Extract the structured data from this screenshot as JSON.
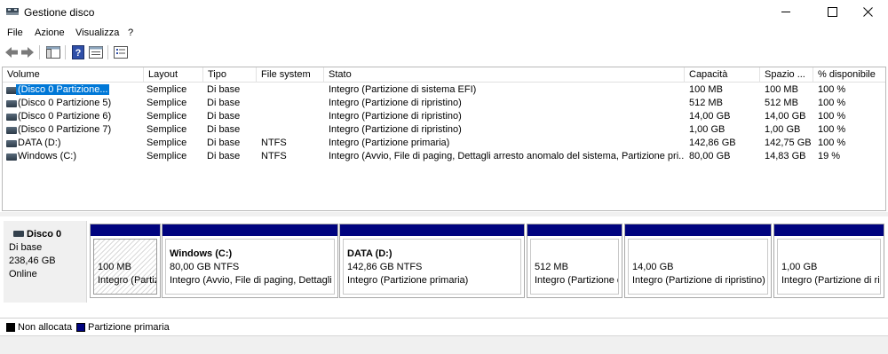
{
  "window": {
    "title": "Gestione disco"
  },
  "menu": {
    "items": [
      "File",
      "Azione",
      "Visualizza",
      "?"
    ]
  },
  "toolbar": {
    "buttons": [
      "back-icon",
      "forward-icon",
      "console-tree-icon",
      "help-icon",
      "properties-icon",
      "disk-list-icon"
    ]
  },
  "list": {
    "columns": [
      "Volume",
      "Layout",
      "Tipo",
      "File system",
      "Stato",
      "Capacità",
      "Spazio ...",
      "% disponibile"
    ],
    "rows": [
      {
        "volume": "(Disco 0 Partizione...",
        "layout": "Semplice",
        "tipo": "Di base",
        "fs": "",
        "stato": "Integro (Partizione di sistema EFI)",
        "capacita": "100 MB",
        "spazio": "100 MB",
        "perc": "100 %",
        "selected": true
      },
      {
        "volume": "(Disco 0 Partizione 5)",
        "layout": "Semplice",
        "tipo": "Di base",
        "fs": "",
        "stato": "Integro (Partizione di ripristino)",
        "capacita": "512 MB",
        "spazio": "512 MB",
        "perc": "100 %"
      },
      {
        "volume": "(Disco 0 Partizione 6)",
        "layout": "Semplice",
        "tipo": "Di base",
        "fs": "",
        "stato": "Integro (Partizione di ripristino)",
        "capacita": "14,00 GB",
        "spazio": "14,00 GB",
        "perc": "100 %"
      },
      {
        "volume": "(Disco 0 Partizione 7)",
        "layout": "Semplice",
        "tipo": "Di base",
        "fs": "",
        "stato": "Integro (Partizione di ripristino)",
        "capacita": "1,00 GB",
        "spazio": "1,00 GB",
        "perc": "100 %"
      },
      {
        "volume": "DATA (D:)",
        "layout": "Semplice",
        "tipo": "Di base",
        "fs": "NTFS",
        "stato": "Integro (Partizione primaria)",
        "capacita": "142,86 GB",
        "spazio": "142,75 GB",
        "perc": "100 %"
      },
      {
        "volume": "Windows (C:)",
        "layout": "Semplice",
        "tipo": "Di base",
        "fs": "NTFS",
        "stato": "Integro (Avvio, File di paging, Dettagli arresto anomalo del sistema, Partizione pri...",
        "capacita": "80,00 GB",
        "spazio": "14,83 GB",
        "perc": "19 %"
      }
    ]
  },
  "disk": {
    "name": "Disco 0",
    "type": "Di base",
    "size": "238,46 GB",
    "status": "Online",
    "partitions": [
      {
        "name": "",
        "size": "100 MB",
        "status": "Integro (Partizi",
        "hatched": true
      },
      {
        "name": "Windows  (C:)",
        "size": "80,00 GB NTFS",
        "status": "Integro (Avvio, File di paging, Dettagli a"
      },
      {
        "name": "DATA  (D:)",
        "size": "142,86 GB NTFS",
        "status": "Integro (Partizione primaria)"
      },
      {
        "name": "",
        "size": "512 MB",
        "status": "Integro (Partizione d"
      },
      {
        "name": "",
        "size": "14,00 GB",
        "status": "Integro (Partizione di ripristino)"
      },
      {
        "name": "",
        "size": "1,00 GB",
        "status": "Integro (Partizione di rip"
      }
    ]
  },
  "legend": {
    "items": [
      {
        "label": "Non allocata",
        "color": "#000000"
      },
      {
        "label": "Partizione primaria",
        "color": "#00037f"
      }
    ]
  }
}
